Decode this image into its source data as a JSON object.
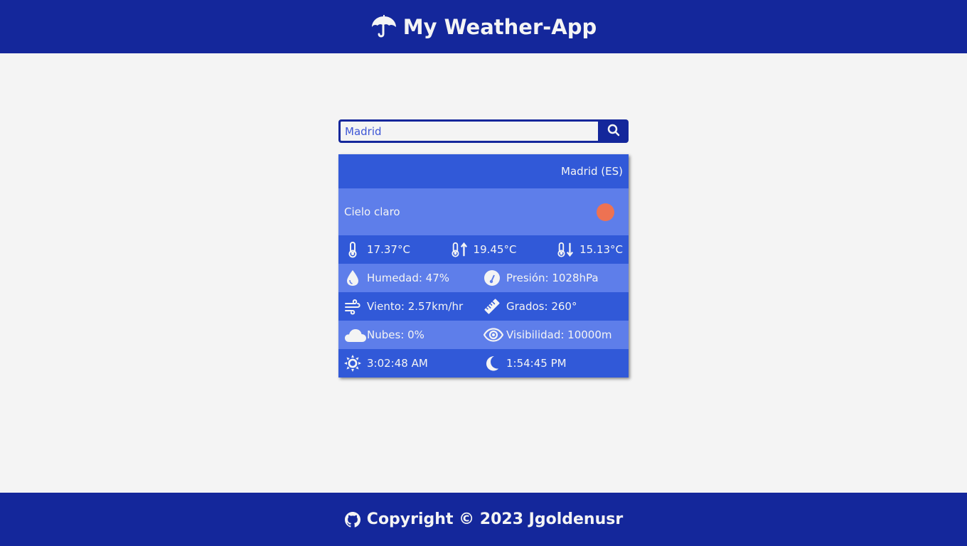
{
  "header": {
    "title": "My Weather-App",
    "icon": "umbrella-icon"
  },
  "search": {
    "value": "Madrid",
    "button_icon": "search-icon"
  },
  "weather": {
    "location": "Madrid (ES)",
    "description": "Cielo claro",
    "condition_icon": "sun-icon",
    "temp": "17.37°C",
    "temp_max": "19.45°C",
    "temp_min": "15.13°C",
    "humidity": "Humedad: 47%",
    "pressure": "Presión: 1028hPa",
    "wind": "Viento: 2.57km/hr",
    "degrees": "Grados: 260°",
    "clouds": "Nubes: 0%",
    "visibility": "Visibilidad: 10000m",
    "sunrise": "3:02:48 AM",
    "sunset": "1:54:45 PM"
  },
  "footer": {
    "text": "Copyright © 2023 Jgoldenusr",
    "icon": "github-icon"
  },
  "colors": {
    "primary": "#14279b",
    "card_dark": "#3159d8",
    "card_light": "#5e7eea",
    "sun": "#ee7252",
    "background": "#f4f4f4"
  }
}
